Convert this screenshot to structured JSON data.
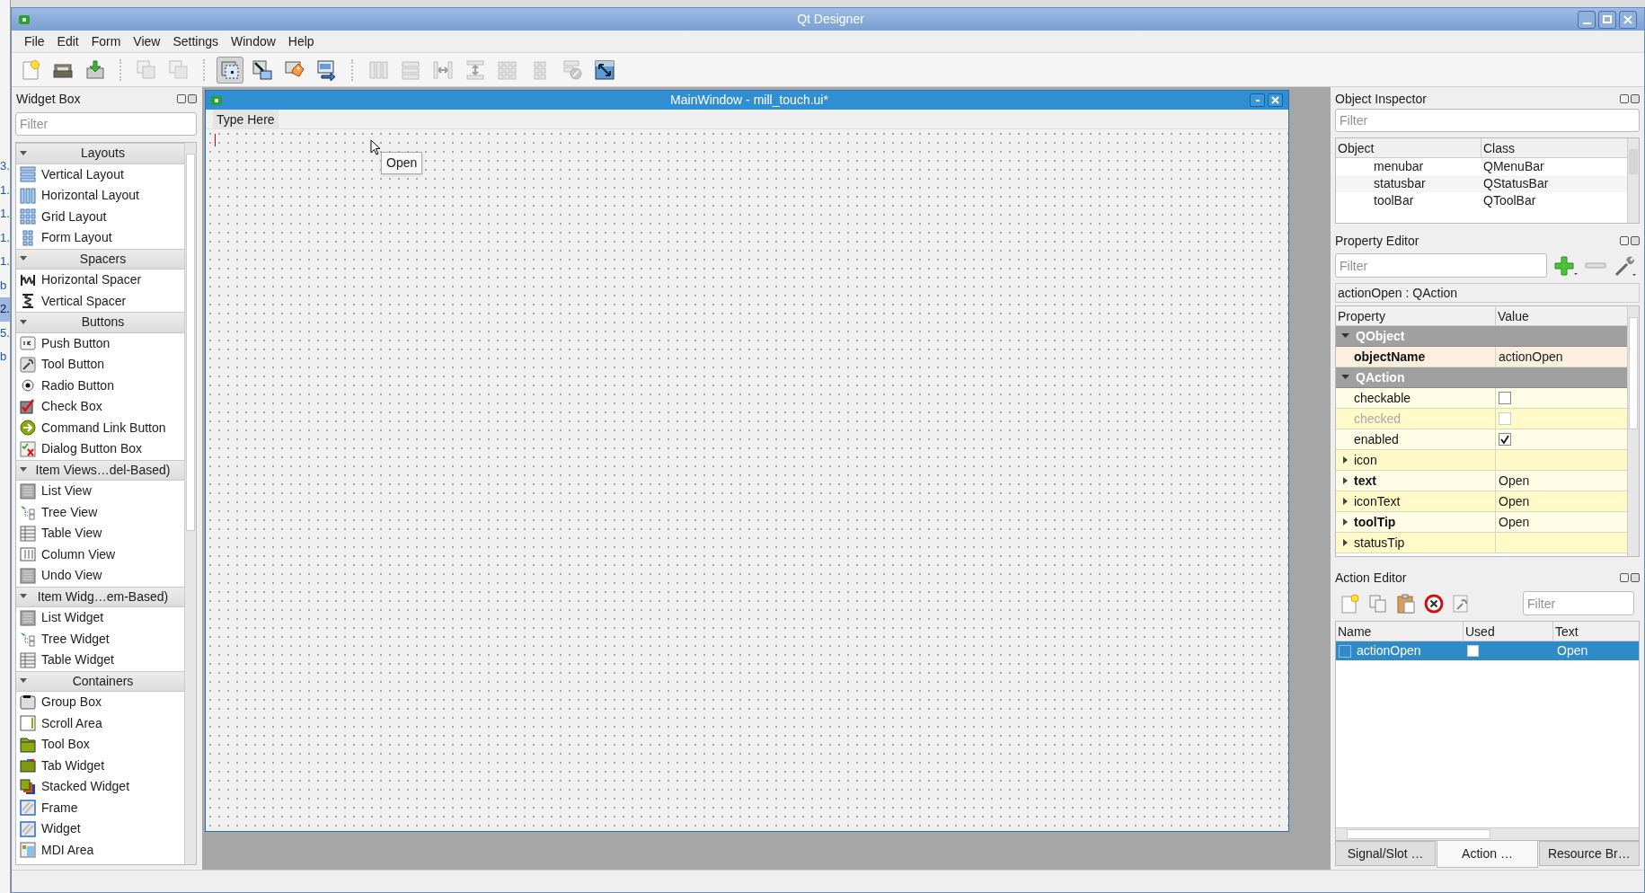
{
  "background_fragments": [
    "3.",
    "1.",
    "1.",
    "1.",
    "1.",
    "b",
    "2.",
    "5.",
    "b"
  ],
  "window": {
    "title": "Qt Designer"
  },
  "menu": [
    "File",
    "Edit",
    "Form",
    "View",
    "Settings",
    "Window",
    "Help"
  ],
  "toolbar": [
    {
      "kind": "new",
      "disabled": false,
      "selected": false
    },
    {
      "kind": "open",
      "disabled": false,
      "selected": false
    },
    {
      "kind": "save",
      "disabled": false,
      "selected": false
    },
    {
      "kind": "sep"
    },
    {
      "kind": "copy",
      "disabled": true,
      "selected": false
    },
    {
      "kind": "square",
      "disabled": true,
      "selected": false
    },
    {
      "kind": "sep"
    },
    {
      "kind": "select",
      "disabled": false,
      "selected": true
    },
    {
      "kind": "signals",
      "disabled": false,
      "selected": false
    },
    {
      "kind": "buddy",
      "disabled": false,
      "selected": false
    },
    {
      "kind": "taborder",
      "disabled": false,
      "selected": false
    },
    {
      "kind": "sep"
    },
    {
      "kind": "hlayout",
      "disabled": true,
      "selected": false
    },
    {
      "kind": "vlayout",
      "disabled": true,
      "selected": false
    },
    {
      "kind": "hsplit",
      "disabled": true,
      "selected": false
    },
    {
      "kind": "vsplit",
      "disabled": true,
      "selected": false
    },
    {
      "kind": "grid",
      "disabled": true,
      "selected": false
    },
    {
      "kind": "form",
      "disabled": true,
      "selected": false
    },
    {
      "kind": "break",
      "disabled": true,
      "selected": false
    },
    {
      "kind": "adjust",
      "disabled": false,
      "selected": false
    }
  ],
  "widget_box": {
    "title": "Widget Box",
    "filter_placeholder": "Filter",
    "categories": [
      {
        "title": "Layouts",
        "expanded": true,
        "items": [
          {
            "label": "Vertical Layout",
            "kind": "vlayout"
          },
          {
            "label": "Horizontal Layout",
            "kind": "hlayout"
          },
          {
            "label": "Grid Layout",
            "kind": "grid"
          },
          {
            "label": "Form Layout",
            "kind": "form"
          }
        ]
      },
      {
        "title": "Spacers",
        "expanded": true,
        "items": [
          {
            "label": "Horizontal Spacer",
            "kind": "hspacer"
          },
          {
            "label": "Vertical Spacer",
            "kind": "vspacer"
          }
        ]
      },
      {
        "title": "Buttons",
        "expanded": true,
        "items": [
          {
            "label": "Push Button",
            "kind": "push"
          },
          {
            "label": "Tool Button",
            "kind": "tool"
          },
          {
            "label": "Radio Button",
            "kind": "radio"
          },
          {
            "label": "Check Box",
            "kind": "check"
          },
          {
            "label": "Command Link Button",
            "kind": "link"
          },
          {
            "label": "Dialog Button Box",
            "kind": "dialog"
          }
        ]
      },
      {
        "title": "Item Views…del-Based)",
        "expanded": true,
        "items": [
          {
            "label": "List View",
            "kind": "list"
          },
          {
            "label": "Tree View",
            "kind": "tree"
          },
          {
            "label": "Table View",
            "kind": "table"
          },
          {
            "label": "Column View",
            "kind": "column"
          },
          {
            "label": "Undo View",
            "kind": "list"
          }
        ]
      },
      {
        "title": "Item Widg…em-Based)",
        "expanded": true,
        "items": [
          {
            "label": "List Widget",
            "kind": "list"
          },
          {
            "label": "Tree Widget",
            "kind": "tree"
          },
          {
            "label": "Table Widget",
            "kind": "table"
          }
        ]
      },
      {
        "title": "Containers",
        "expanded": true,
        "items": [
          {
            "label": "Group Box",
            "kind": "group"
          },
          {
            "label": "Scroll Area",
            "kind": "scroll"
          },
          {
            "label": "Tool Box",
            "kind": "toolbox"
          },
          {
            "label": "Tab Widget",
            "kind": "tab"
          },
          {
            "label": "Stacked Widget",
            "kind": "stacked"
          },
          {
            "label": "Frame",
            "kind": "frame"
          },
          {
            "label": "Widget",
            "kind": "frame"
          },
          {
            "label": "MDI Area",
            "kind": "mdi"
          }
        ]
      }
    ]
  },
  "form_window": {
    "title": "MainWindow - mill_touch.ui*",
    "menu_placeholder": "Type Here",
    "tooltip": "Open"
  },
  "object_inspector": {
    "title": "Object Inspector",
    "filter_placeholder": "Filter",
    "columns": [
      "Object",
      "Class"
    ],
    "rows": [
      {
        "object": "menubar",
        "class": "QMenuBar"
      },
      {
        "object": "statusbar",
        "class": "QStatusBar"
      },
      {
        "object": "toolBar",
        "class": "QToolBar"
      }
    ]
  },
  "property_editor": {
    "title": "Property Editor",
    "filter_placeholder": "Filter",
    "object_label": "actionOpen : QAction",
    "columns": [
      "Property",
      "Value"
    ],
    "rows": [
      {
        "kind": "group",
        "name": "QObject",
        "expanded": true
      },
      {
        "kind": "text",
        "name": "objectName",
        "value": "actionOpen",
        "bold": true,
        "disabled": false,
        "expandable": false,
        "color": "#fdefe0"
      },
      {
        "kind": "group",
        "name": "QAction",
        "expanded": true
      },
      {
        "kind": "check",
        "name": "checkable",
        "checked": false,
        "bold": false,
        "disabled": false,
        "expandable": false,
        "color": "#fffde6"
      },
      {
        "kind": "check",
        "name": "checked",
        "checked": false,
        "bold": false,
        "disabled": true,
        "expandable": false,
        "color": "#fffac8"
      },
      {
        "kind": "check",
        "name": "enabled",
        "checked": true,
        "bold": false,
        "disabled": false,
        "expandable": false,
        "color": "#fffde6"
      },
      {
        "kind": "text",
        "name": "icon",
        "bold": false,
        "disabled": false,
        "expandable": true,
        "color": "#fffac8"
      },
      {
        "kind": "text",
        "name": "text",
        "value": "Open",
        "bold": true,
        "disabled": false,
        "expandable": true,
        "color": "#fffde6"
      },
      {
        "kind": "text",
        "name": "iconText",
        "value": "Open",
        "bold": false,
        "disabled": false,
        "expandable": true,
        "color": "#fffac8"
      },
      {
        "kind": "text",
        "name": "toolTip",
        "value": "Open",
        "bold": true,
        "disabled": false,
        "expandable": true,
        "color": "#fffde6"
      },
      {
        "kind": "text",
        "name": "statusTip",
        "bold": false,
        "disabled": false,
        "expandable": true,
        "color": "#fffac8"
      }
    ]
  },
  "action_editor": {
    "title": "Action Editor",
    "filter_placeholder": "Filter",
    "columns": [
      "Name",
      "Used",
      "Text"
    ],
    "rows": [
      {
        "name": "actionOpen",
        "used": false,
        "text": "Open",
        "selected": true
      }
    ]
  },
  "bottom_tabs": [
    {
      "label": "Signal/Slot …",
      "selected": false
    },
    {
      "label": "Action …",
      "selected": true
    },
    {
      "label": "Resource Br…",
      "selected": false
    }
  ]
}
